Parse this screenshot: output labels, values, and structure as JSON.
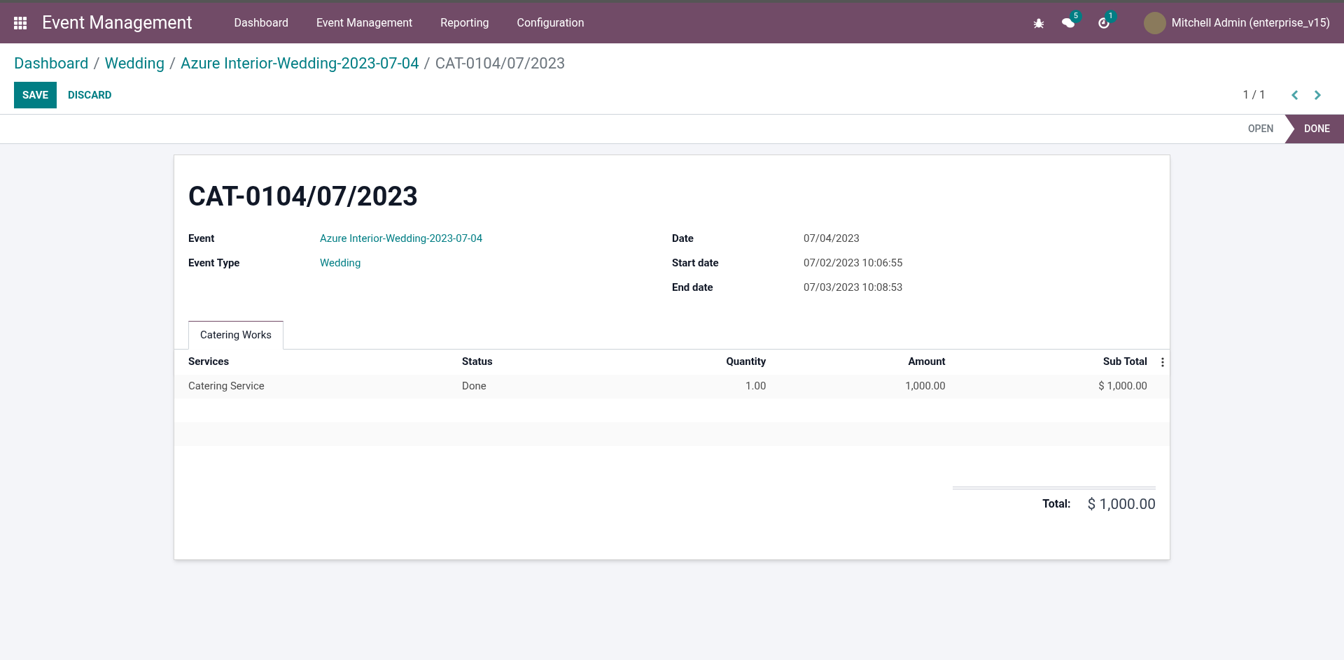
{
  "navbar": {
    "app_title": "Event Management",
    "menu": [
      "Dashboard",
      "Event Management",
      "Reporting",
      "Configuration"
    ],
    "messages_count": "5",
    "activities_count": "1",
    "user": "Mitchell Admin (enterprise_v15)"
  },
  "breadcrumbs": [
    {
      "label": "Dashboard",
      "current": false
    },
    {
      "separator": "/",
      "label": "Wedding",
      "current": false
    },
    {
      "separator": "/",
      "label": "Azure Interior-Wedding-2023-07-04",
      "current": false
    },
    {
      "separator": "/",
      "label": "CAT-0104/07/2023",
      "current": true
    }
  ],
  "actions": {
    "save": "SAVE",
    "discard": "DISCARD"
  },
  "pager": "1 / 1",
  "statusbar": [
    {
      "label": "OPEN",
      "selected": false
    },
    {
      "label": "DONE",
      "selected": true
    }
  ],
  "form": {
    "title": "CAT-0104/07/2023",
    "left_fields": [
      {
        "label": "Event",
        "value": "Azure Interior-Wedding-2023-07-04",
        "kind": "link"
      },
      {
        "label": "Event Type",
        "value": "Wedding",
        "kind": "link"
      }
    ],
    "right_fields": [
      {
        "label": "Date",
        "value": "07/04/2023"
      },
      {
        "label": "Start date",
        "value": "07/02/2023 10:06:55"
      },
      {
        "label": "End date",
        "value": "07/03/2023 10:08:53"
      }
    ],
    "tabs": [
      {
        "label": "Catering Works",
        "selected": true
      }
    ],
    "table": {
      "columns": [
        "Services",
        "Status",
        "Quantity",
        "Amount",
        "Sub Total"
      ],
      "rows": [
        [
          "Catering Service",
          "Done",
          "1.00",
          "1,000.00",
          "$ 1,000.00"
        ]
      ]
    },
    "total_label": "Total:",
    "total_value": "$ 1,000.00"
  }
}
